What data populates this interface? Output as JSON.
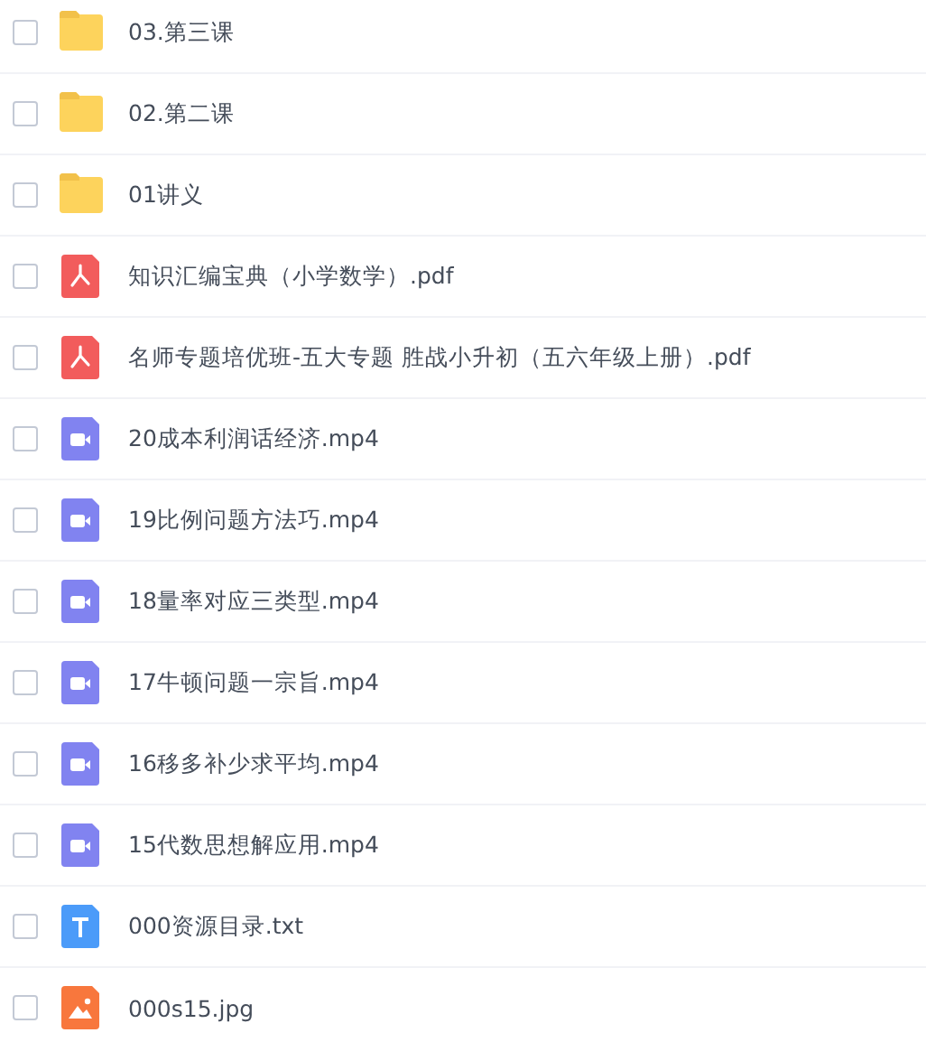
{
  "files": [
    {
      "name": "03.第三课",
      "kind": "folder",
      "checked": false
    },
    {
      "name": "02.第二课",
      "kind": "folder",
      "checked": false
    },
    {
      "name": "01讲义",
      "kind": "folder",
      "checked": false
    },
    {
      "name": "知识汇编宝典（小学数学）.pdf",
      "kind": "pdf",
      "checked": false
    },
    {
      "name": "名师专题培优班-五大专题 胜战小升初（五六年级上册）.pdf",
      "kind": "pdf",
      "checked": false
    },
    {
      "name": "20成本利润话经济.mp4",
      "kind": "video",
      "checked": false
    },
    {
      "name": "19比例问题方法巧.mp4",
      "kind": "video",
      "checked": false
    },
    {
      "name": "18量率对应三类型.mp4",
      "kind": "video",
      "checked": false
    },
    {
      "name": "17牛顿问题一宗旨.mp4",
      "kind": "video",
      "checked": false
    },
    {
      "name": "16移多补少求平均.mp4",
      "kind": "video",
      "checked": false
    },
    {
      "name": "15代数思想解应用.mp4",
      "kind": "video",
      "checked": false
    },
    {
      "name": "000资源目录.txt",
      "kind": "text",
      "checked": false
    },
    {
      "name": "000s15.jpg",
      "kind": "image",
      "checked": false
    }
  ]
}
